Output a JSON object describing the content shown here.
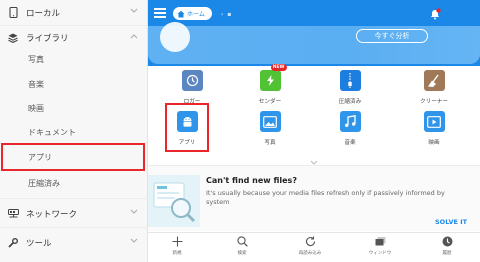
{
  "colors": {
    "accent": "#1b88e7",
    "highlight": "#e8262b"
  },
  "sidebar": {
    "local": {
      "label": "ローカル",
      "icon": "phone-icon"
    },
    "library": {
      "label": "ライブラリ",
      "icon": "stack-icon"
    },
    "library_items": [
      "写真",
      "音楽",
      "映画",
      "ドキュメント",
      "アプリ",
      "圧縮済み"
    ],
    "network": {
      "label": "ネットワーク",
      "icon": "network-icon"
    },
    "tools": {
      "label": "ツール",
      "icon": "wrench-icon"
    }
  },
  "topbar": {
    "home_label": "ホーム"
  },
  "banner": {
    "button_label": "今すぐ分析"
  },
  "grid": [
    {
      "label": "ロガー",
      "icon": "logger-icon",
      "color": "#5b86c2"
    },
    {
      "label": "センダー",
      "icon": "sender-icon",
      "color": "#52c235",
      "badge": "NEW"
    },
    {
      "label": "圧縮済み",
      "icon": "zip-icon",
      "color": "#1e7ee0"
    },
    {
      "label": "クリーナー",
      "icon": "broom-icon",
      "color": "#a07958"
    },
    {
      "label": "アプリ",
      "icon": "android-icon",
      "color": "#2f95ea"
    },
    {
      "label": "写真",
      "icon": "image-icon",
      "color": "#2f95ea"
    },
    {
      "label": "音楽",
      "icon": "music-icon",
      "color": "#2f95ea"
    },
    {
      "label": "映画",
      "icon": "video-icon",
      "color": "#2f95ea"
    }
  ],
  "card": {
    "title": "Can't find new files?",
    "text": "It's usually because your media files refresh only if passively informed by system",
    "action": "SOLVE IT"
  },
  "bottombar": [
    {
      "label": "新規",
      "icon": "plus-icon"
    },
    {
      "label": "検索",
      "icon": "search-icon"
    },
    {
      "label": "再読み込み",
      "icon": "refresh-icon"
    },
    {
      "label": "ウィンドウ",
      "icon": "windows-icon"
    },
    {
      "label": "履歴",
      "icon": "history-icon"
    }
  ]
}
